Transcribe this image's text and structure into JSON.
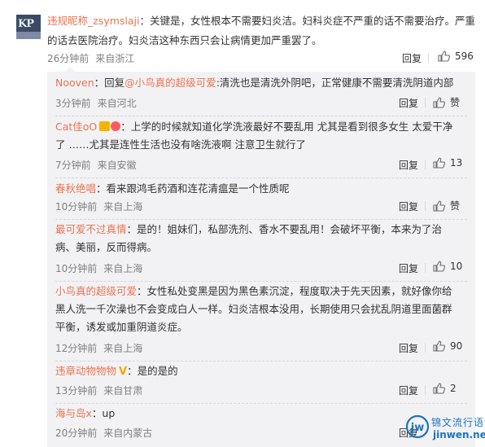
{
  "main": {
    "username": "违规昵称_zsymslaji",
    "text": "：关键是，女性根本不需要妇炎洁。妇科炎症不严重的话不需要治疗。严重的话去医院治疗。妇炎洁这种东西只会让病情更加严重罢了。",
    "time": "26分钟前",
    "location": "来自浙江",
    "reply_label": "回复",
    "like_count": "596"
  },
  "replies": [
    {
      "username": "Nooven",
      "text": "：回复@小鸟真的超级可爱:清洗也是清洗外阴吧，正常健康不需要清洗阴道内部",
      "mention": "@小鸟真的超级可爱",
      "time": "3分钟前",
      "location": "来自河北",
      "reply_label": "回复",
      "like_label": "赞"
    },
    {
      "username": "Cat佳oO",
      "text": "：上学的时候就知道化学洗液最好不要乱用 尤其是看到很多女生 太爱干净了 ……尤其是连性生活也没有啥洗液啊 注意卫生就行了",
      "time": "7分钟前",
      "location": "来自安徽",
      "reply_label": "回复",
      "like_label": "13"
    },
    {
      "username": "春秋绝唱",
      "text": "：看来跟鸿毛药酒和连花清瘟是一个性质呢",
      "time": "10分钟前",
      "location": "来自上海",
      "reply_label": "回复",
      "like_label": "赞"
    },
    {
      "username": "最可爱不过真情",
      "text": "：是的！姐妹们，私部洗剂、香水不要乱用！会破坏平衡，本来为了治病、美丽，反而得病。",
      "time": "10分钟前",
      "location": "来自上海",
      "reply_label": "回复",
      "like_label": "10"
    },
    {
      "username": "小鸟真的超级可爱",
      "text": "：女性私处变黑是因为黑色素沉淀，程度取决于先天因素，就好像你给黑人洗一千次澡也不会变成白人一样。妇炎洁根本没用，长期使用只会扰乱阴道里面菌群平衡，诱发或加重阴道炎症。",
      "time": "12分钟前",
      "location": "来自上海",
      "reply_label": "回复",
      "like_label": "90"
    },
    {
      "username": "违章动物物物",
      "text": "：是的是的",
      "time": "13分钟前",
      "location": "来自甘肃",
      "reply_label": "回复",
      "like_label": "2"
    },
    {
      "username": "海与岛x",
      "text": "：up",
      "time": "20分钟前",
      "location": "来自内蒙古",
      "reply_label": "回复",
      "like_label": ""
    }
  ],
  "watermark": {
    "line1": "锦文流行语",
    "line2": "jinwen.net",
    "logo_text": "jw"
  },
  "avatar": {
    "text": "KP"
  },
  "colors": {
    "username": "#eb7350",
    "meta": "#808080",
    "reply_bg": "#f2f2f5",
    "watermark": "#1b75bc"
  }
}
